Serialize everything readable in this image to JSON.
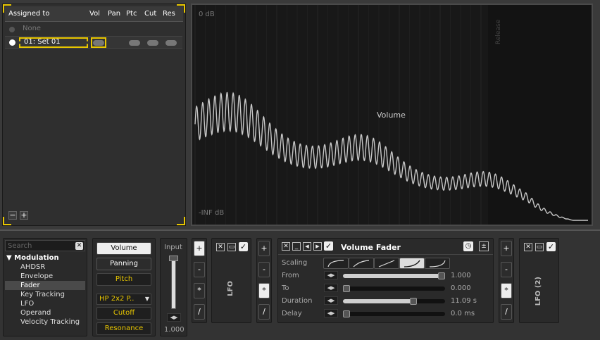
{
  "assign": {
    "headers": [
      "Assigned to",
      "Vol",
      "Pan",
      "Ptc",
      "Cut",
      "Res"
    ],
    "rows": [
      {
        "label": "None",
        "selected": false
      },
      {
        "label": "01: Set 01",
        "selected": true
      }
    ],
    "minus": "−",
    "plus": "+"
  },
  "graph": {
    "top_label": "0 dB",
    "bottom_label": "-INF dB",
    "release_label": "Release",
    "curve_label": "Volume",
    "colors": {
      "curve": "#c8c8c8",
      "background": "#181818"
    }
  },
  "browser": {
    "search_placeholder": "Search",
    "category": "Modulation",
    "items": [
      "AHDSR",
      "Envelope",
      "Fader",
      "Key Tracking",
      "LFO",
      "Operand",
      "Velocity Tracking"
    ],
    "selected": "Fader"
  },
  "targets": {
    "volume": "Volume",
    "panning": "Panning",
    "pitch": "Pitch",
    "filter_type": "HP 2x2 P..",
    "cutoff": "Cutoff",
    "resonance": "Resonance"
  },
  "input": {
    "label": "Input",
    "value": "1.000",
    "level": 1.0
  },
  "ops": [
    "+",
    "-",
    "*",
    "/"
  ],
  "lfo1": {
    "title": "LFO"
  },
  "lfo2": {
    "title": "LFO (2)"
  },
  "fader": {
    "title": "Volume Fader",
    "params": [
      {
        "label": "Scaling",
        "value": ""
      },
      {
        "label": "From",
        "value": "1.000",
        "level": 1.0
      },
      {
        "label": "To",
        "value": "0.000",
        "level": 0.0
      },
      {
        "label": "Duration",
        "value": "11.09 s",
        "level": 0.7
      },
      {
        "label": "Delay",
        "value": "0.0 ms",
        "level": 0.0
      }
    ],
    "minus_btn": "_"
  }
}
